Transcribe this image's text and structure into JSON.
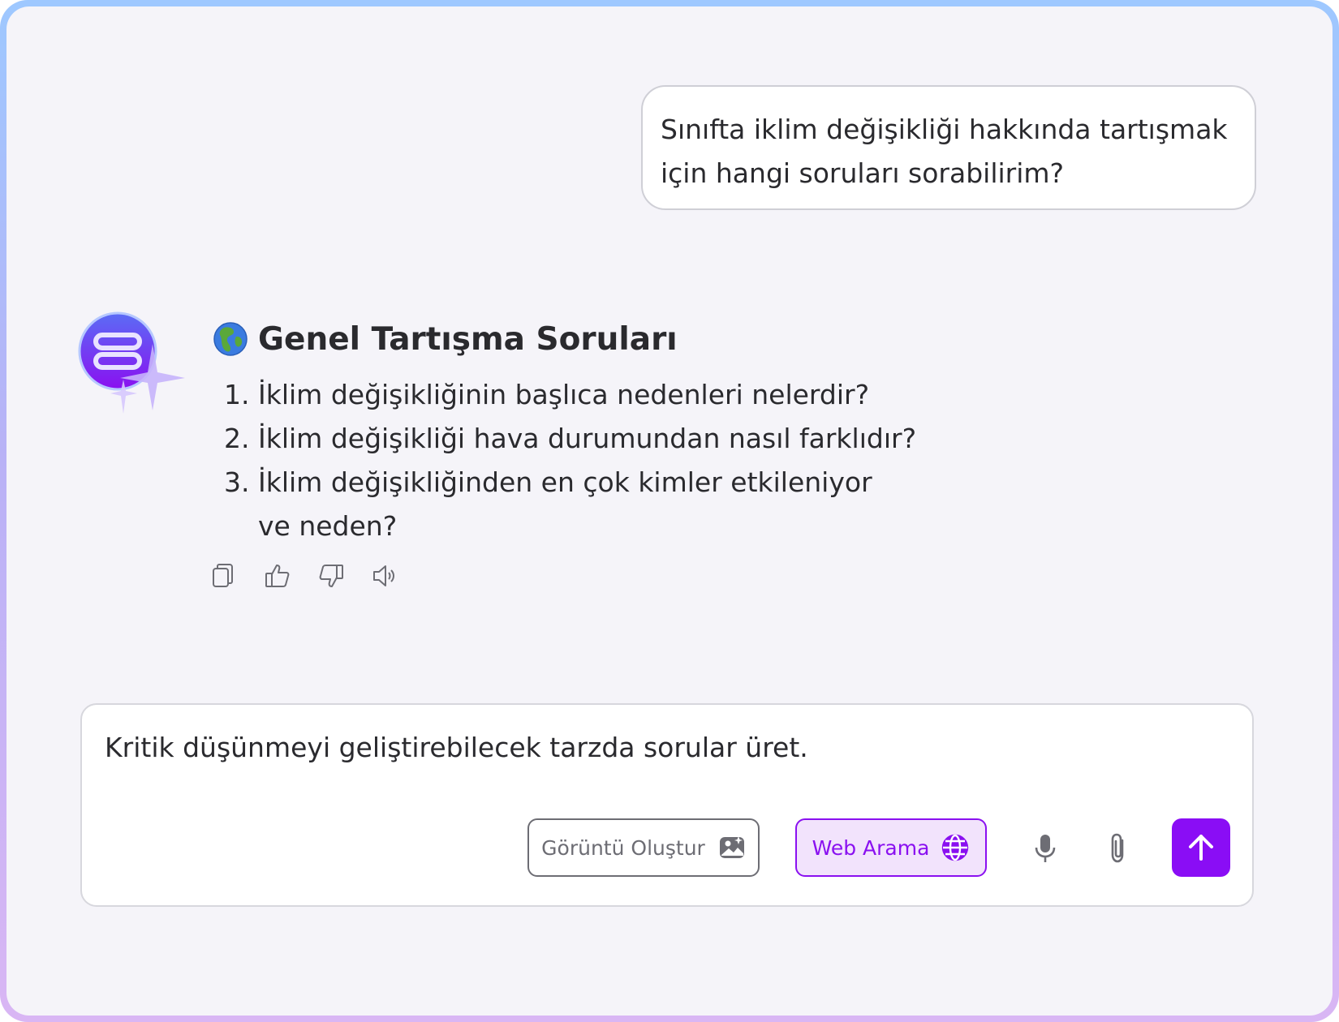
{
  "user_message": {
    "line1": "Sınıfta iklim değişikliği hakkında tartışmak",
    "line2": "için hangi soruları sorabilirim?"
  },
  "assistant": {
    "avatar_icon": "assistant-logo-icon",
    "title_emoji_icon": "globe-europe-africa-icon",
    "title": "Genel Tartışma Soruları",
    "questions": [
      {
        "num": "1.",
        "text": "İklim değişikliğinin başlıca nedenleri nelerdir?"
      },
      {
        "num": "2.",
        "text": "İklim değişikliği hava durumundan nasıl farklıdır?"
      },
      {
        "num": "3.",
        "text": "İklim değişikliğinden en çok kimler etkileniyor ve neden?"
      }
    ],
    "actions": [
      "copy-icon",
      "thumbs-up-icon",
      "thumbs-down-icon",
      "speaker-icon"
    ]
  },
  "composer": {
    "input_text": "Kritik düşünmeyi geliştirebilecek tarzda sorular üret.",
    "image_button_label": "Görüntü Oluştur",
    "web_button_label": "Web Arama",
    "colors": {
      "accent": "#8a0df5",
      "accent_soft": "#f2e3fc",
      "muted": "#6d6d74"
    }
  }
}
